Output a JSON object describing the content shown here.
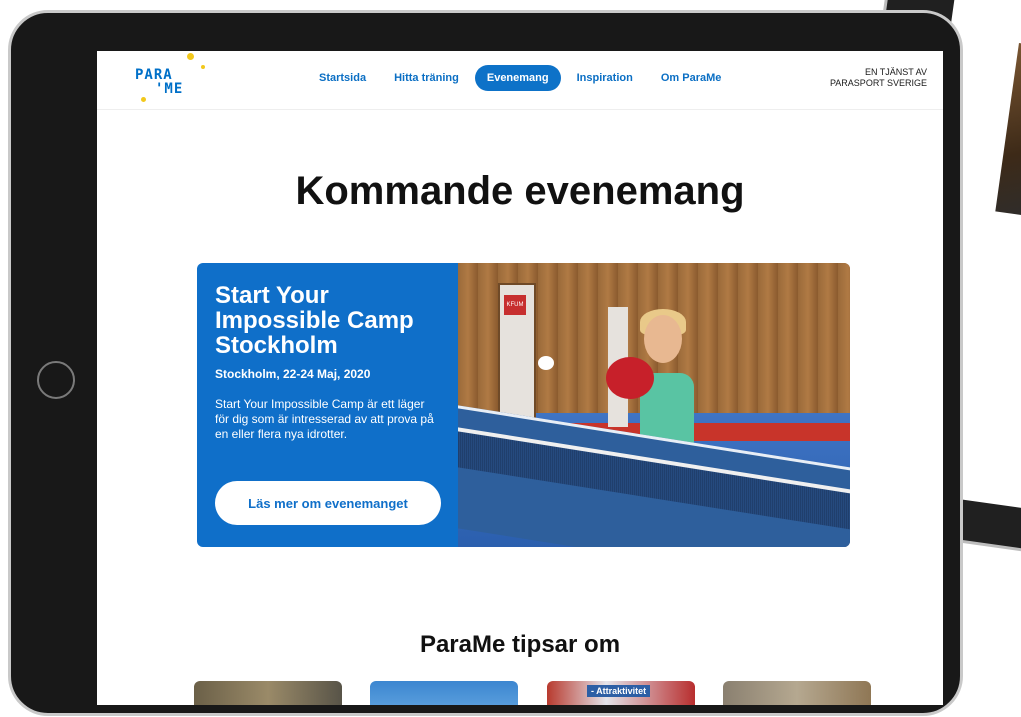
{
  "brand": {
    "logo_line1": "PARA",
    "logo_line2": "'ME",
    "accent": "#0f6fc9",
    "dot_color": "#f2c81c"
  },
  "header": {
    "nav": [
      "Startsida",
      "Hitta träning",
      "Evenemang",
      "Inspiration",
      "Om ParaMe"
    ],
    "active_nav": "Evenemang",
    "service_line1": "EN TJÄNST AV",
    "service_line2": "PARASPORT SVERIGE"
  },
  "page": {
    "title": "Kommande evenemang"
  },
  "event": {
    "title": "Start Your Impossible Camp Stockholm",
    "meta": "Stockholm, 22-24 Maj, 2020",
    "description": "Start Your Impossible Camp är ett läger för dig som är intresserad av att prova på en eller flera nya idrotter.",
    "cta": "Läs mer om evenemanget"
  },
  "tips": {
    "title": "ParaMe tipsar om",
    "card3_label": "- Attraktivitet"
  }
}
